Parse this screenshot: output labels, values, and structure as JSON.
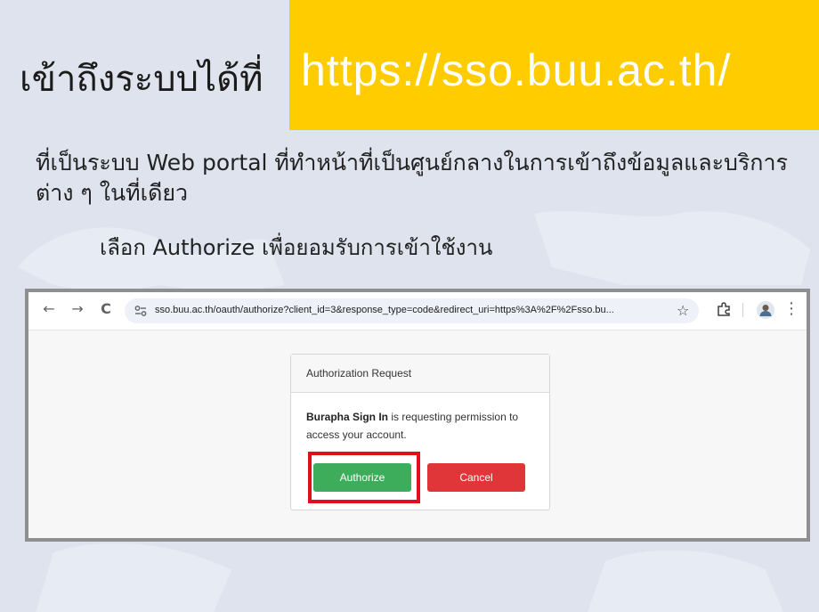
{
  "slide": {
    "title_prefix": "เข้าถึงระบบได้ที่",
    "url": "https://sso.buu.ac.th/",
    "description": "ที่เป็นระบบ Web portal ที่ทำหน้าที่เป็นศูนย์กลางในการเข้าถึงข้อมูลและบริการต่าง ๆ ในที่เดียว",
    "instruction": "เลือก Authorize เพื่อยอมรับการเข้าใช้งาน",
    "colors": {
      "banner": "#ffcc00",
      "background": "#dfe3ee",
      "highlight": "#e0101a"
    }
  },
  "browser": {
    "back_icon": "←",
    "forward_icon": "→",
    "reload_icon": "C",
    "address_url": "sso.buu.ac.th/oauth/authorize?client_id=3&response_type=code&redirect_uri=https%3A%2F%2Fsso.bu...",
    "star_icon": "☆",
    "menu_icon": "⋮"
  },
  "auth_card": {
    "header": "Authorization Request",
    "app_name": "Burapha Sign In",
    "message": " is requesting permission to access your account.",
    "authorize_label": "Authorize",
    "cancel_label": "Cancel",
    "colors": {
      "authorize": "#3dad5c",
      "cancel": "#e0363a"
    }
  }
}
